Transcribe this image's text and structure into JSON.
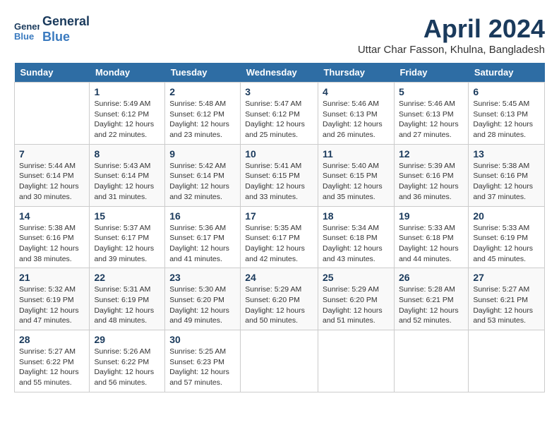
{
  "header": {
    "logo_line1": "General",
    "logo_line2": "Blue",
    "month_title": "April 2024",
    "subtitle": "Uttar Char Fasson, Khulna, Bangladesh"
  },
  "days_of_week": [
    "Sunday",
    "Monday",
    "Tuesday",
    "Wednesday",
    "Thursday",
    "Friday",
    "Saturday"
  ],
  "weeks": [
    [
      {
        "day": "",
        "info": ""
      },
      {
        "day": "1",
        "info": "Sunrise: 5:49 AM\nSunset: 6:12 PM\nDaylight: 12 hours\nand 22 minutes."
      },
      {
        "day": "2",
        "info": "Sunrise: 5:48 AM\nSunset: 6:12 PM\nDaylight: 12 hours\nand 23 minutes."
      },
      {
        "day": "3",
        "info": "Sunrise: 5:47 AM\nSunset: 6:12 PM\nDaylight: 12 hours\nand 25 minutes."
      },
      {
        "day": "4",
        "info": "Sunrise: 5:46 AM\nSunset: 6:13 PM\nDaylight: 12 hours\nand 26 minutes."
      },
      {
        "day": "5",
        "info": "Sunrise: 5:46 AM\nSunset: 6:13 PM\nDaylight: 12 hours\nand 27 minutes."
      },
      {
        "day": "6",
        "info": "Sunrise: 5:45 AM\nSunset: 6:13 PM\nDaylight: 12 hours\nand 28 minutes."
      }
    ],
    [
      {
        "day": "7",
        "info": "Sunrise: 5:44 AM\nSunset: 6:14 PM\nDaylight: 12 hours\nand 30 minutes."
      },
      {
        "day": "8",
        "info": "Sunrise: 5:43 AM\nSunset: 6:14 PM\nDaylight: 12 hours\nand 31 minutes."
      },
      {
        "day": "9",
        "info": "Sunrise: 5:42 AM\nSunset: 6:14 PM\nDaylight: 12 hours\nand 32 minutes."
      },
      {
        "day": "10",
        "info": "Sunrise: 5:41 AM\nSunset: 6:15 PM\nDaylight: 12 hours\nand 33 minutes."
      },
      {
        "day": "11",
        "info": "Sunrise: 5:40 AM\nSunset: 6:15 PM\nDaylight: 12 hours\nand 35 minutes."
      },
      {
        "day": "12",
        "info": "Sunrise: 5:39 AM\nSunset: 6:16 PM\nDaylight: 12 hours\nand 36 minutes."
      },
      {
        "day": "13",
        "info": "Sunrise: 5:38 AM\nSunset: 6:16 PM\nDaylight: 12 hours\nand 37 minutes."
      }
    ],
    [
      {
        "day": "14",
        "info": "Sunrise: 5:38 AM\nSunset: 6:16 PM\nDaylight: 12 hours\nand 38 minutes."
      },
      {
        "day": "15",
        "info": "Sunrise: 5:37 AM\nSunset: 6:17 PM\nDaylight: 12 hours\nand 39 minutes."
      },
      {
        "day": "16",
        "info": "Sunrise: 5:36 AM\nSunset: 6:17 PM\nDaylight: 12 hours\nand 41 minutes."
      },
      {
        "day": "17",
        "info": "Sunrise: 5:35 AM\nSunset: 6:17 PM\nDaylight: 12 hours\nand 42 minutes."
      },
      {
        "day": "18",
        "info": "Sunrise: 5:34 AM\nSunset: 6:18 PM\nDaylight: 12 hours\nand 43 minutes."
      },
      {
        "day": "19",
        "info": "Sunrise: 5:33 AM\nSunset: 6:18 PM\nDaylight: 12 hours\nand 44 minutes."
      },
      {
        "day": "20",
        "info": "Sunrise: 5:33 AM\nSunset: 6:19 PM\nDaylight: 12 hours\nand 45 minutes."
      }
    ],
    [
      {
        "day": "21",
        "info": "Sunrise: 5:32 AM\nSunset: 6:19 PM\nDaylight: 12 hours\nand 47 minutes."
      },
      {
        "day": "22",
        "info": "Sunrise: 5:31 AM\nSunset: 6:19 PM\nDaylight: 12 hours\nand 48 minutes."
      },
      {
        "day": "23",
        "info": "Sunrise: 5:30 AM\nSunset: 6:20 PM\nDaylight: 12 hours\nand 49 minutes."
      },
      {
        "day": "24",
        "info": "Sunrise: 5:29 AM\nSunset: 6:20 PM\nDaylight: 12 hours\nand 50 minutes."
      },
      {
        "day": "25",
        "info": "Sunrise: 5:29 AM\nSunset: 6:20 PM\nDaylight: 12 hours\nand 51 minutes."
      },
      {
        "day": "26",
        "info": "Sunrise: 5:28 AM\nSunset: 6:21 PM\nDaylight: 12 hours\nand 52 minutes."
      },
      {
        "day": "27",
        "info": "Sunrise: 5:27 AM\nSunset: 6:21 PM\nDaylight: 12 hours\nand 53 minutes."
      }
    ],
    [
      {
        "day": "28",
        "info": "Sunrise: 5:27 AM\nSunset: 6:22 PM\nDaylight: 12 hours\nand 55 minutes."
      },
      {
        "day": "29",
        "info": "Sunrise: 5:26 AM\nSunset: 6:22 PM\nDaylight: 12 hours\nand 56 minutes."
      },
      {
        "day": "30",
        "info": "Sunrise: 5:25 AM\nSunset: 6:23 PM\nDaylight: 12 hours\nand 57 minutes."
      },
      {
        "day": "",
        "info": ""
      },
      {
        "day": "",
        "info": ""
      },
      {
        "day": "",
        "info": ""
      },
      {
        "day": "",
        "info": ""
      }
    ]
  ]
}
